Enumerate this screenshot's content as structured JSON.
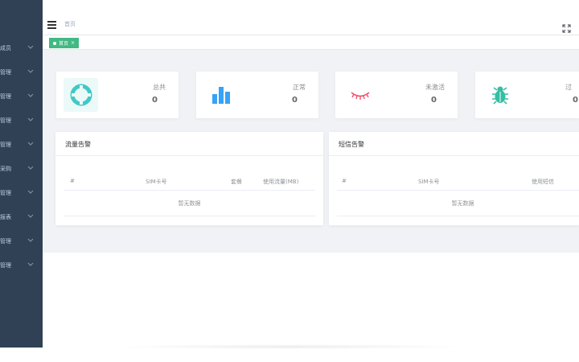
{
  "sidebar": {
    "items": [
      {
        "label": "成员"
      },
      {
        "label": "管理"
      },
      {
        "label": "管理"
      },
      {
        "label": "管理"
      },
      {
        "label": "管理"
      },
      {
        "label": "采购"
      },
      {
        "label": "管理"
      },
      {
        "label": "报表"
      },
      {
        "label": "管理"
      },
      {
        "label": "管理"
      }
    ]
  },
  "topbar": {
    "breadcrumb": "首页"
  },
  "tags": [
    {
      "label": "首页",
      "close": "×"
    }
  ],
  "panels": [
    {
      "title": "总共",
      "value": "0",
      "icon": "lifebuoy-icon",
      "color": "#40c9c6"
    },
    {
      "title": "正常",
      "value": "0",
      "icon": "bar-chart-icon",
      "color": "#36a3f7"
    },
    {
      "title": "未激活",
      "value": "0",
      "icon": "closed-eye-icon",
      "color": "#f4516c"
    },
    {
      "title": "过",
      "value": "0",
      "icon": "bug-icon",
      "color": "#34bfa3"
    }
  ],
  "traffic_alert": {
    "title": "流量告警",
    "columns": [
      "#",
      "SIM卡号",
      "套餐",
      "使用流量(MB)"
    ],
    "empty_text": "暂无数据"
  },
  "sms_alert": {
    "title": "短信告警",
    "columns": [
      "#",
      "SIM卡号",
      "使用短信"
    ],
    "empty_text": "暂无数据"
  }
}
